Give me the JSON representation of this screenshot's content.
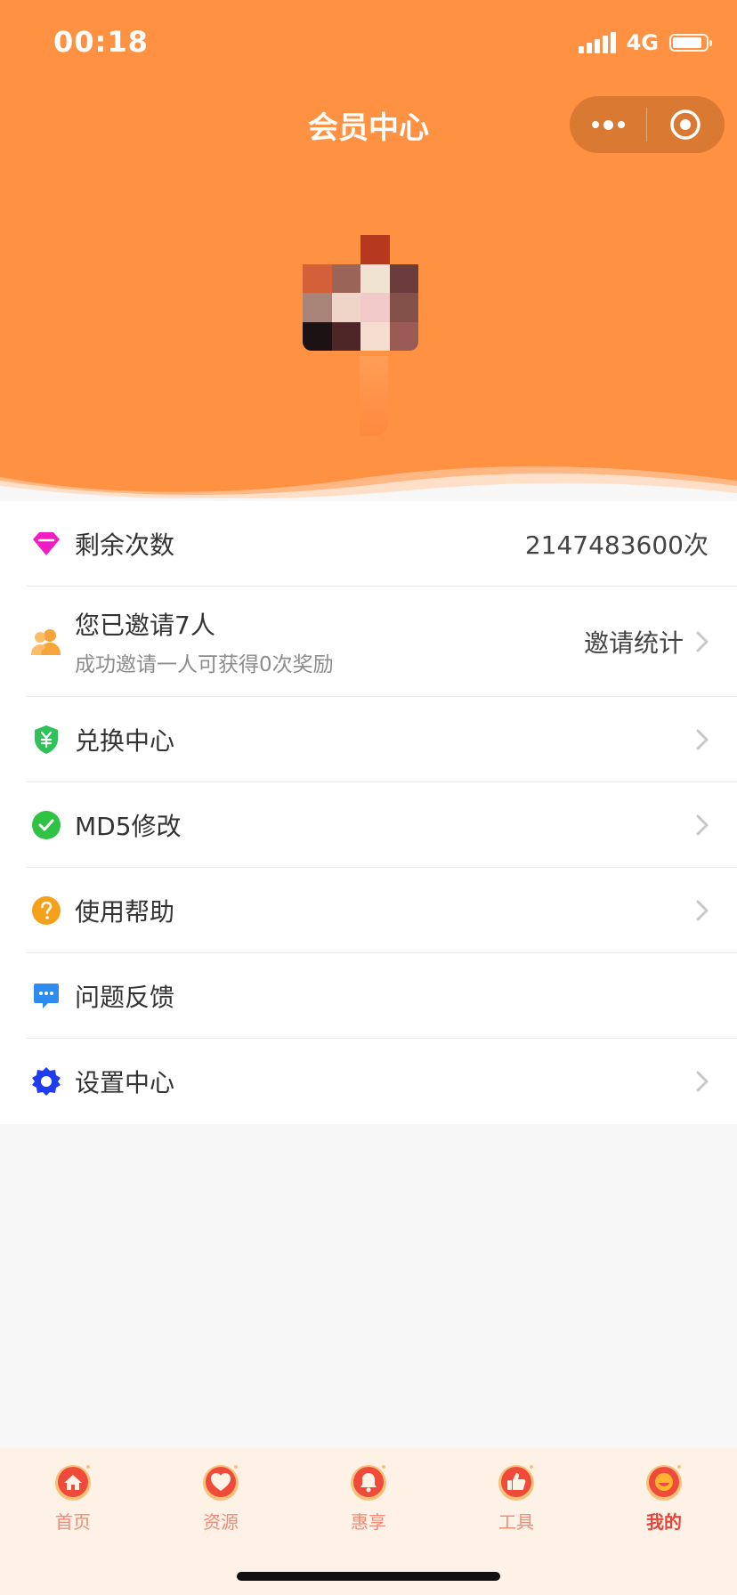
{
  "status_bar": {
    "time": "00:18",
    "network": "4G"
  },
  "nav": {
    "title": "会员中心"
  },
  "list": {
    "remaining": {
      "label": "剩余次数",
      "value": "2147483600次",
      "icon": "diamond-icon"
    },
    "invite": {
      "label": "您已邀请7人",
      "sub": "成功邀请一人可获得0次奖励",
      "link": "邀请统计",
      "icon": "users-icon"
    },
    "redeem": {
      "label": "兑换中心",
      "icon": "yen-shield-icon"
    },
    "md5": {
      "label": "MD5修改",
      "icon": "check-circle-icon"
    },
    "help": {
      "label": "使用帮助",
      "icon": "question-circle-icon"
    },
    "feedback": {
      "label": "问题反馈",
      "icon": "chat-bubble-icon"
    },
    "settings": {
      "label": "设置中心",
      "icon": "gear-icon"
    }
  },
  "tabbar": {
    "items": [
      {
        "label": "首页",
        "icon": "home-icon"
      },
      {
        "label": "资源",
        "icon": "heart-icon"
      },
      {
        "label": "惠享",
        "icon": "bell-icon"
      },
      {
        "label": "工具",
        "icon": "thumbs-up-icon"
      },
      {
        "label": "我的",
        "icon": "smile-icon"
      }
    ],
    "active_index": 4
  },
  "colors": {
    "header": "#ff9242",
    "tab_label": "#f28a78",
    "tab_label_active": "#e8453a"
  }
}
